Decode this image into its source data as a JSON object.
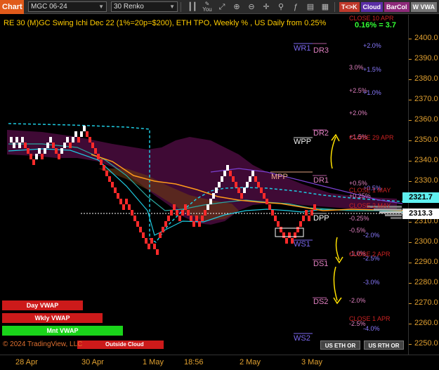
{
  "toolbar": {
    "tab_label": "Chart",
    "instrument": "MGC 06-24",
    "bar_type": "30 Renko",
    "you_label": "You",
    "btn_tk": "T<>K",
    "btn_cloud": "Cloud",
    "btn_barcol": "BarCol",
    "btn_vwap": "W VWA"
  },
  "header": {
    "title": "RE 30 (M)GC Swing Ichi Dec 22 (1%=20p=$200), ETH TPO, Weekly % , US Daily from 0.25%",
    "pct": "0.16% = 3.7",
    "close_label_top": "CLOSE 10 APR"
  },
  "price_axis": {
    "ticks": [
      "2400.0",
      "2390.0",
      "2380.0",
      "2370.0",
      "2360.0",
      "2350.0",
      "2340.0",
      "2330.0",
      "2320.0",
      "2310.0",
      "2300.0",
      "2290.0",
      "2280.0",
      "2270.0",
      "2260.0",
      "2250.0"
    ],
    "last_price": "2321.7",
    "current_price": "2313.3"
  },
  "time_axis": {
    "labels": [
      "28 Apr",
      "30 Apr",
      "1 May",
      "18:56",
      "2 May",
      "3 May"
    ]
  },
  "levels": {
    "wr1": "WR1",
    "dr3": "DR3",
    "dr2": "DR2",
    "wpp": "WPP",
    "mpp": "MPP",
    "dr1": "DR1",
    "dpp": "DPP",
    "ws1": "WS1",
    "ds1": "DS1",
    "ds2": "DS2",
    "ws2": "WS2"
  },
  "percent_labels": {
    "p_2_0_top": "+2.0%",
    "p_3_0": "3.0%",
    "p_1_5": "+1.5%",
    "p_2_5": "+2.5%",
    "p_1_0": "+1.0%",
    "p_2_0": "+2.0%",
    "p_1_5b": "+1.5%",
    "p_0_5": "+0.5%",
    "p_0_25": "+0.25%",
    "p_0_5b": "+0.5%",
    "m_0_25": "-0.25%",
    "m_0_5": "-0.5%",
    "m_2_0": "-2.0%",
    "m_1_0": "-1.0%",
    "m_2_5": "-2.5%",
    "m_3_0": "-3.0%",
    "m_2_0b": "-2.0%",
    "m_2_5b": "-2.5%",
    "m_4_0": "-4.0%"
  },
  "close_labels": {
    "c29": "CLOSE 29 APR",
    "c1may": "CLOSE 1 MAY",
    "c2may": "CLOSE 2 MAY",
    "c2apr": "CLOSE 2 APR",
    "c1apr": "CLOSE 1 APR"
  },
  "vwap_boxes": {
    "day": "Day VWAP",
    "wkly": "Wkly VWAP",
    "mnt": "Mnt VWAP"
  },
  "footer": {
    "copyright": "© 2024 TradingView, LLC",
    "outside_cloud": "Outside Cloud",
    "btn_eth": "US ETH OR",
    "btn_rth": "US RTH OR"
  },
  "colors": {
    "accent": "#e05a1a",
    "axis": "#e0a030",
    "bull": "#ffffff",
    "bear": "#ff2a2a",
    "cloud": "#5a1050",
    "cyan": "#1ecbe1",
    "orange": "#ff9a1a",
    "green": "#33ff33",
    "yellow_arrow": "#ffe000"
  }
}
